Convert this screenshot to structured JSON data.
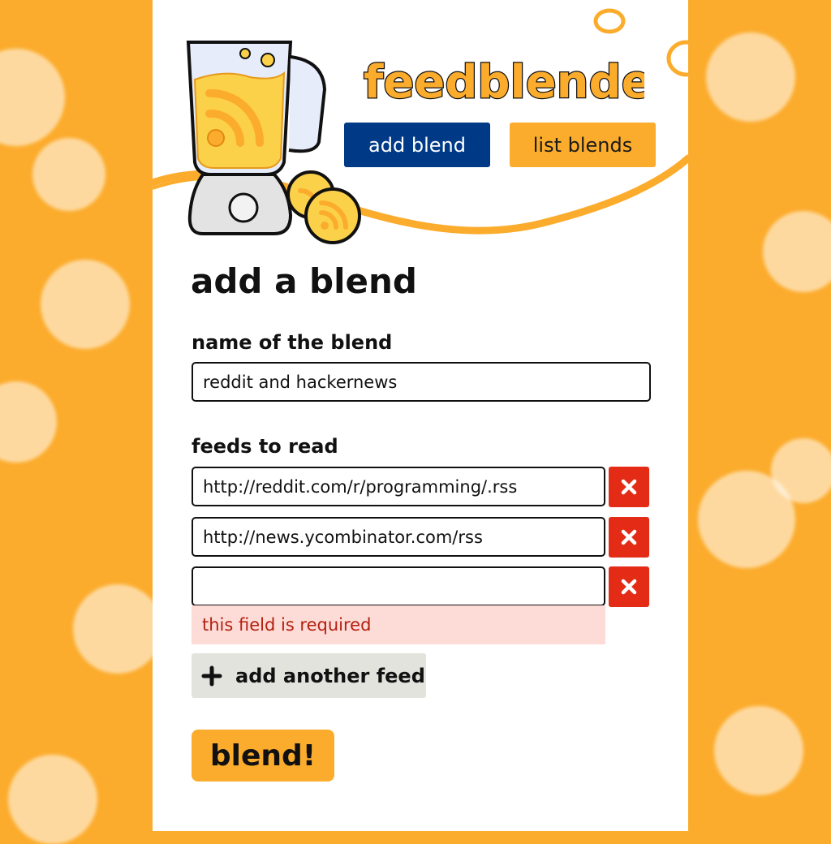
{
  "brand": {
    "name": "feedblender"
  },
  "nav": {
    "add_blend": "add blend",
    "list_blends": "list blends"
  },
  "form": {
    "title": "add a blend",
    "name_label": "name of the blend",
    "name_value": "reddit and hackernews",
    "feeds_label": "feeds to read",
    "feeds": [
      {
        "value": "http://reddit.com/r/programming/.rss"
      },
      {
        "value": "http://news.ycombinator.com/rss"
      },
      {
        "value": ""
      }
    ],
    "error_message": "this field is required",
    "add_feed_label": "add another feed",
    "submit_label": "blend!"
  },
  "colors": {
    "background": "#fcac2c",
    "nav_primary": "#003a87",
    "nav_secondary": "#fcac2c",
    "remove": "#e32b16",
    "error_bg": "#fddbd6",
    "error_text": "#b32010"
  },
  "icons": {
    "logo": "blender-rss-icon",
    "remove": "close-icon",
    "add": "plus-icon"
  }
}
